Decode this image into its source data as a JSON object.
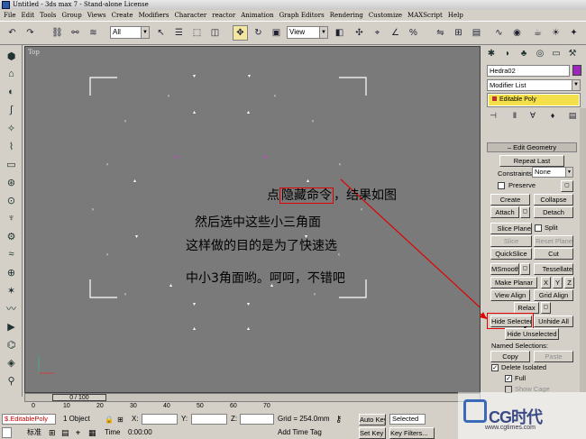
{
  "title": "Untitled - 3ds max 7 - Stand-alone License",
  "menu": [
    "File",
    "Edit",
    "Tools",
    "Group",
    "Views",
    "Create",
    "Modifiers",
    "Character",
    "reactor",
    "Animation",
    "Graph Editors",
    "Rendering",
    "Customize",
    "MAXScript",
    "Help"
  ],
  "toolbar": {
    "selection_filter": "All",
    "coord_system": "View"
  },
  "viewport": {
    "label": "Top"
  },
  "annotations": {
    "line1_pre": "点",
    "line1_box": "隐藏命令",
    "line1_post": "，结果如图",
    "line2": "然后选中这些小三角面",
    "line3": "这样做的目的是为了快速选",
    "line4": "中小3角面哟。呵呵，不错吧"
  },
  "command_panel": {
    "object_name": "Hedra02",
    "modifier_list": "Modifier List",
    "stack_item": "Editable Poly",
    "rollout_title": "Edit Geometry",
    "repeat_last": "Repeat Last",
    "constraints_label": "Constraints:",
    "constraints_value": "None",
    "preserve_label": "Preserve",
    "create": "Create",
    "collapse": "Collapse",
    "attach": "Attach",
    "detach": "Detach",
    "slice_plane": "Slice Plane",
    "split": "Split",
    "slice": "Slice",
    "reset_plane": "Reset Plane",
    "quickslice": "QuickSlice",
    "cut": "Cut",
    "msmooth": "MSmooth",
    "tessellate": "Tessellate",
    "make_planar": "Make Planar",
    "x": "X",
    "y": "Y",
    "z": "Z",
    "view_align": "View Align",
    "grid_align": "Grid Align",
    "relax": "Relax",
    "hide_selected": "Hide Selected",
    "unhide_all": "Unhide All",
    "hide_unselected": "Hide Unselected",
    "named_selections": "Named Selections:",
    "copy": "Copy",
    "paste": "Paste",
    "delete_isolated": "Delete Isolated",
    "full": "Full",
    "show_cage": "Show Cage"
  },
  "timeline": {
    "position": "0 / 100",
    "ticks": [
      "0",
      "10",
      "20",
      "30",
      "40",
      "50",
      "60",
      "70"
    ]
  },
  "status": {
    "maxscript_field": "$.EditablePoly",
    "selection": "1 Object",
    "x_label": "X:",
    "y_label": "Y:",
    "z_label": "Z:",
    "grid": "Grid = 254.0mm",
    "auto_key": "Auto Key",
    "key_mode": "Selected",
    "script_text": "标准",
    "time_label": "Time",
    "time_value": "0:00:00",
    "add_time_tag": "Add Time Tag",
    "set_key": "Set Key",
    "key_filters": "Key Filters..."
  },
  "watermark": {
    "brand": "CG时代",
    "url": "www.cgtimes.com"
  }
}
